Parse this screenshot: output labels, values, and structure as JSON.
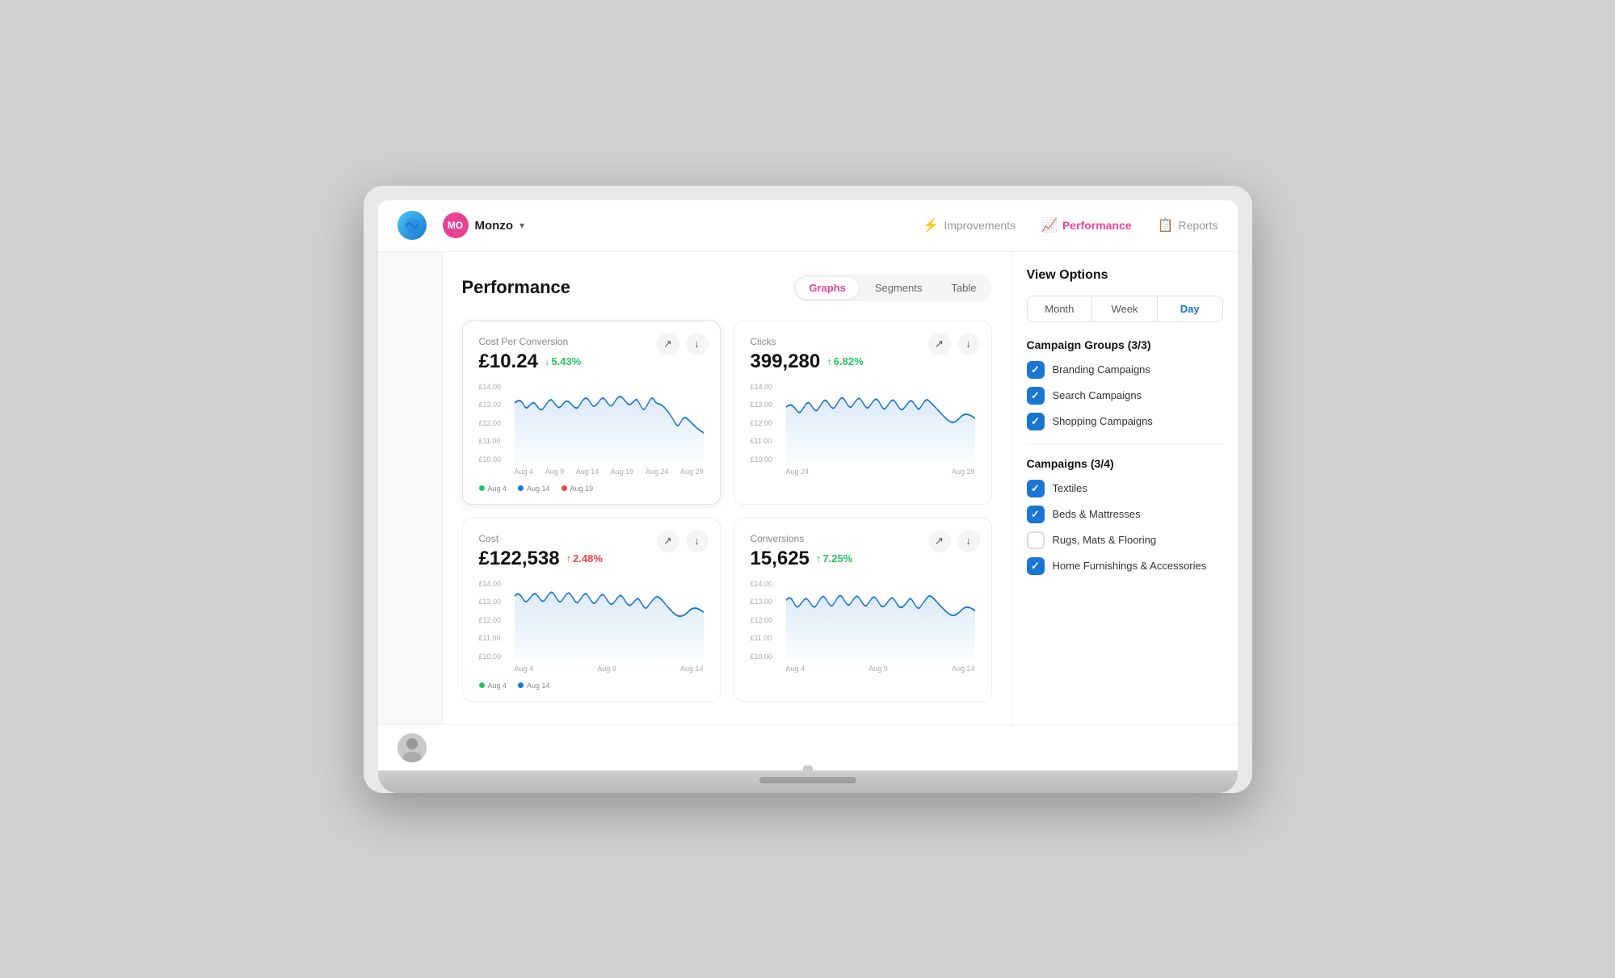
{
  "nav": {
    "logo_alt": "App Logo",
    "brand": {
      "initials": "MO",
      "name": "Monzo",
      "dropdown_icon": "▾"
    },
    "items": [
      {
        "id": "improvements",
        "label": "Improvements",
        "icon": "⚡",
        "active": false
      },
      {
        "id": "performance",
        "label": "Performance",
        "icon": "📈",
        "active": true
      },
      {
        "id": "reports",
        "label": "Reports",
        "icon": "📋",
        "active": false
      }
    ]
  },
  "page": {
    "title": "Performance",
    "view_tabs": [
      {
        "id": "graphs",
        "label": "Graphs",
        "active": true
      },
      {
        "id": "segments",
        "label": "Segments",
        "active": false
      },
      {
        "id": "table",
        "label": "Table",
        "active": false
      }
    ]
  },
  "metrics": [
    {
      "id": "cost_per_conversion",
      "label": "Cost Per Conversion",
      "value": "£10.24",
      "change": "5.43%",
      "change_direction": "down",
      "change_color": "down",
      "y_labels": [
        "£14.00",
        "£13.00",
        "£12.00",
        "£11.00",
        "£10.00"
      ],
      "x_labels": [
        "Aug 4",
        "Aug 9",
        "Aug 14",
        "Aug 19",
        "Aug 24",
        "Aug 29"
      ],
      "legend": [
        {
          "color": "#22c55e",
          "label": "Aug 4"
        },
        {
          "color": "#1976d2",
          "label": "Aug 14"
        },
        {
          "color": "#ef4444",
          "label": "Aug 19"
        }
      ]
    },
    {
      "id": "clicks",
      "label": "Clicks",
      "value": "399,280",
      "change": "6.82%",
      "change_direction": "up",
      "change_color": "up",
      "y_labels": [
        "£14.00",
        "£13.00",
        "£12.00",
        "£11.00",
        "£10.00"
      ],
      "x_labels": [
        "Aug 24",
        "Aug 29"
      ],
      "legend": []
    },
    {
      "id": "cost",
      "label": "Cost",
      "value": "£122,538",
      "change": "2.48%",
      "change_direction": "up",
      "change_color": "up-red",
      "y_labels": [
        "£14.00",
        "£13.00",
        "£12.00",
        "£11.00",
        "£10.00"
      ],
      "x_labels": [
        "Aug 4",
        "Aug 9",
        "Aug 14"
      ],
      "legend": [
        {
          "color": "#22c55e",
          "label": "Aug 4"
        },
        {
          "color": "#1976d2",
          "label": "Aug 14"
        }
      ]
    },
    {
      "id": "conversions",
      "label": "Conversions",
      "value": "15,625",
      "change": "7.25%",
      "change_direction": "up",
      "change_color": "up",
      "y_labels": [
        "£14.00",
        "£13.00",
        "£12.00",
        "£11.00",
        "£10.00"
      ],
      "x_labels": [
        "Aug 4",
        "Aug 9",
        "Aug 14"
      ],
      "legend": []
    }
  ],
  "right_panel": {
    "title": "View Options",
    "time_options": [
      {
        "id": "month",
        "label": "Month",
        "active": false
      },
      {
        "id": "week",
        "label": "Week",
        "active": false
      },
      {
        "id": "day",
        "label": "Day",
        "active": true
      }
    ],
    "campaign_groups": {
      "heading": "Campaign Groups (3/3)",
      "items": [
        {
          "id": "branding",
          "label": "Branding Campaigns",
          "checked": true
        },
        {
          "id": "search",
          "label": "Search Campaigns",
          "checked": true
        },
        {
          "id": "shopping",
          "label": "Shopping Campaigns",
          "checked": true
        }
      ]
    },
    "campaigns": {
      "heading": "Campaigns (3/4)",
      "items": [
        {
          "id": "textiles",
          "label": "Textiles",
          "checked": true
        },
        {
          "id": "beds",
          "label": "Beds & Mattresses",
          "checked": true
        },
        {
          "id": "rugs",
          "label": "Rugs, Mats & Flooring",
          "checked": false
        },
        {
          "id": "home",
          "label": "Home Furnishings & Accessories",
          "checked": true
        }
      ]
    }
  }
}
